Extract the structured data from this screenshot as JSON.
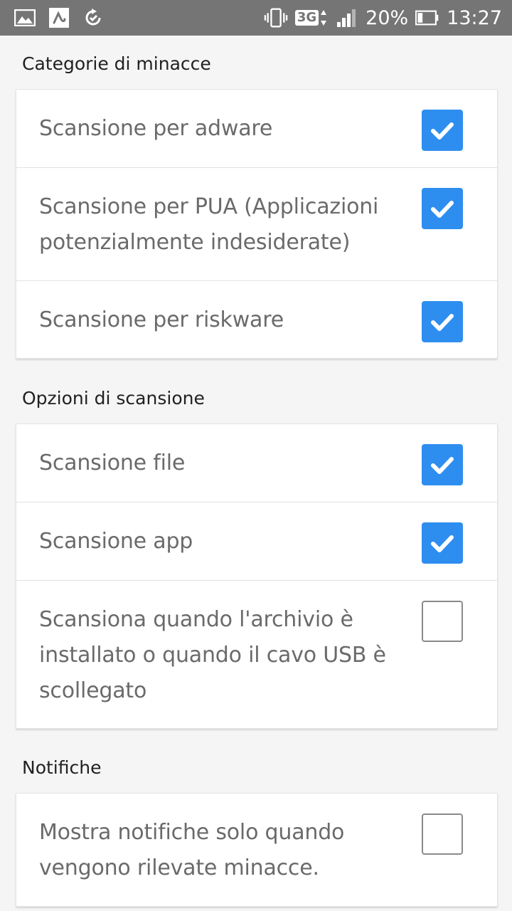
{
  "status_bar": {
    "icons_left": [
      "image-icon",
      "avira-app-icon",
      "sync-check-icon"
    ],
    "icons_right": [
      "vibrate-icon",
      "3g-data-icon",
      "signal-icon"
    ],
    "network": "3G",
    "battery_percent": "20%",
    "time": "13:27"
  },
  "sections": [
    {
      "title": "Categorie di minacce",
      "rows": [
        {
          "label": "Scansione per adware",
          "checked": true
        },
        {
          "label": "Scansione per PUA (Applicazioni potenzialmente indesiderate)",
          "checked": true
        },
        {
          "label": "Scansione per riskware",
          "checked": true
        }
      ]
    },
    {
      "title": "Opzioni di scansione",
      "rows": [
        {
          "label": "Scansione file",
          "checked": true
        },
        {
          "label": "Scansione app",
          "checked": true
        },
        {
          "label": "Scansiona quando l'archivio è installato o quando il cavo USB è scollegato",
          "checked": false
        }
      ]
    },
    {
      "title": "Notifiche",
      "rows": [
        {
          "label": "Mostra notifiche solo quando vengono rilevate minacce.",
          "checked": false
        }
      ]
    }
  ],
  "colors": {
    "status_bar": "#757575",
    "checkbox_checked": "#2e8ef0",
    "background": "#f5f5f5"
  }
}
